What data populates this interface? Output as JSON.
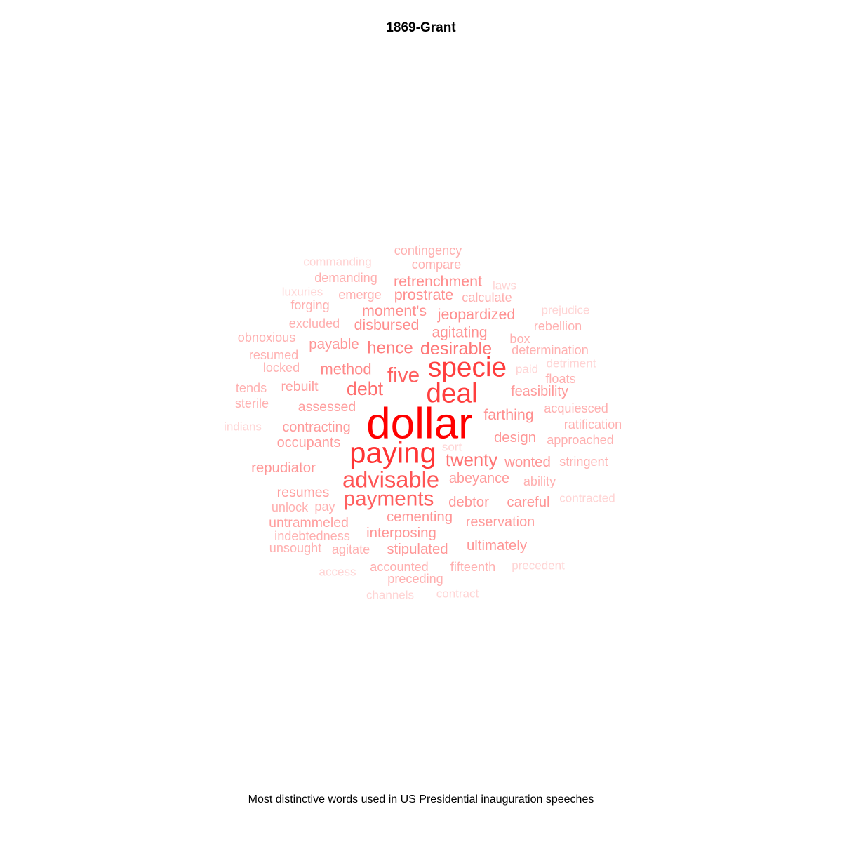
{
  "title": "1869-Grant",
  "caption": "Most distinctive words used in US Presidential inauguration speeches",
  "chart_data": {
    "type": "wordcloud",
    "color_low": "#ffd4d4",
    "color_high": "#ff0000",
    "words": [
      {
        "text": "dollar",
        "weight": 10
      },
      {
        "text": "paying",
        "weight": 7
      },
      {
        "text": "specie",
        "weight": 6.5
      },
      {
        "text": "deal",
        "weight": 6.5
      },
      {
        "text": "advisable",
        "weight": 5.5
      },
      {
        "text": "payments",
        "weight": 5
      },
      {
        "text": "five",
        "weight": 5
      },
      {
        "text": "debt",
        "weight": 4.5
      },
      {
        "text": "twenty",
        "weight": 4.3
      },
      {
        "text": "desirable",
        "weight": 4.2
      },
      {
        "text": "hence",
        "weight": 4
      },
      {
        "text": "method",
        "weight": 3.6
      },
      {
        "text": "farthing",
        "weight": 3.5
      },
      {
        "text": "jeopardized",
        "weight": 3.5
      },
      {
        "text": "moment's",
        "weight": 3.5
      },
      {
        "text": "disbursed",
        "weight": 3.5
      },
      {
        "text": "retrenchment",
        "weight": 3.5
      },
      {
        "text": "prostrate",
        "weight": 3.5
      },
      {
        "text": "agitating",
        "weight": 3.4
      },
      {
        "text": "payable",
        "weight": 3.3
      },
      {
        "text": "repudiator",
        "weight": 3.3
      },
      {
        "text": "cementing",
        "weight": 3.3
      },
      {
        "text": "stipulated",
        "weight": 3.3
      },
      {
        "text": "interposing",
        "weight": 3.3
      },
      {
        "text": "ultimately",
        "weight": 3.3
      },
      {
        "text": "design",
        "weight": 3.3
      },
      {
        "text": "debtor",
        "weight": 3.3
      },
      {
        "text": "careful",
        "weight": 3.3
      },
      {
        "text": "wonted",
        "weight": 3.3
      },
      {
        "text": "abeyance",
        "weight": 3.2
      },
      {
        "text": "reservation",
        "weight": 3.2
      },
      {
        "text": "contracting",
        "weight": 3.2
      },
      {
        "text": "occupants",
        "weight": 3.2
      },
      {
        "text": "feasibility",
        "weight": 3.2
      },
      {
        "text": "assessed",
        "weight": 3.1
      },
      {
        "text": "untrammeled",
        "weight": 3.1
      },
      {
        "text": "resumes",
        "weight": 3.1
      },
      {
        "text": "rebuilt",
        "weight": 3.1
      },
      {
        "text": "contingency",
        "weight": 2.8
      },
      {
        "text": "compare",
        "weight": 2.8
      },
      {
        "text": "demanding",
        "weight": 2.8
      },
      {
        "text": "emerge",
        "weight": 2.8
      },
      {
        "text": "calculate",
        "weight": 2.8
      },
      {
        "text": "forging",
        "weight": 2.8
      },
      {
        "text": "excluded",
        "weight": 2.8
      },
      {
        "text": "obnoxious",
        "weight": 2.8
      },
      {
        "text": "resumed",
        "weight": 2.8
      },
      {
        "text": "locked",
        "weight": 2.8
      },
      {
        "text": "tends",
        "weight": 2.8
      },
      {
        "text": "sterile",
        "weight": 2.8
      },
      {
        "text": "rebellion",
        "weight": 2.8
      },
      {
        "text": "box",
        "weight": 2.8
      },
      {
        "text": "determination",
        "weight": 2.8
      },
      {
        "text": "floats",
        "weight": 2.8
      },
      {
        "text": "acquiesced",
        "weight": 2.8
      },
      {
        "text": "ratification",
        "weight": 2.8
      },
      {
        "text": "approached",
        "weight": 2.8
      },
      {
        "text": "stringent",
        "weight": 2.8
      },
      {
        "text": "ability",
        "weight": 2.8
      },
      {
        "text": "pay",
        "weight": 2.8
      },
      {
        "text": "unlock",
        "weight": 2.8
      },
      {
        "text": "indebtedness",
        "weight": 2.8
      },
      {
        "text": "unsought",
        "weight": 2.8
      },
      {
        "text": "agitate",
        "weight": 2.8
      },
      {
        "text": "accounted",
        "weight": 2.8
      },
      {
        "text": "preceding",
        "weight": 2.8
      },
      {
        "text": "fifteenth",
        "weight": 2.8
      },
      {
        "text": "commanding",
        "weight": 2.5
      },
      {
        "text": "laws",
        "weight": 2.5
      },
      {
        "text": "luxuries",
        "weight": 2.5
      },
      {
        "text": "prejudice",
        "weight": 2.5
      },
      {
        "text": "paid",
        "weight": 2.5
      },
      {
        "text": "detriment",
        "weight": 2.5
      },
      {
        "text": "sort",
        "weight": 2.5
      },
      {
        "text": "indians",
        "weight": 2.5
      },
      {
        "text": "contracted",
        "weight": 2.5
      },
      {
        "text": "access",
        "weight": 2.5
      },
      {
        "text": "precedent",
        "weight": 2.5
      },
      {
        "text": "channels",
        "weight": 2.5
      },
      {
        "text": "contract",
        "weight": 2.5
      }
    ]
  }
}
